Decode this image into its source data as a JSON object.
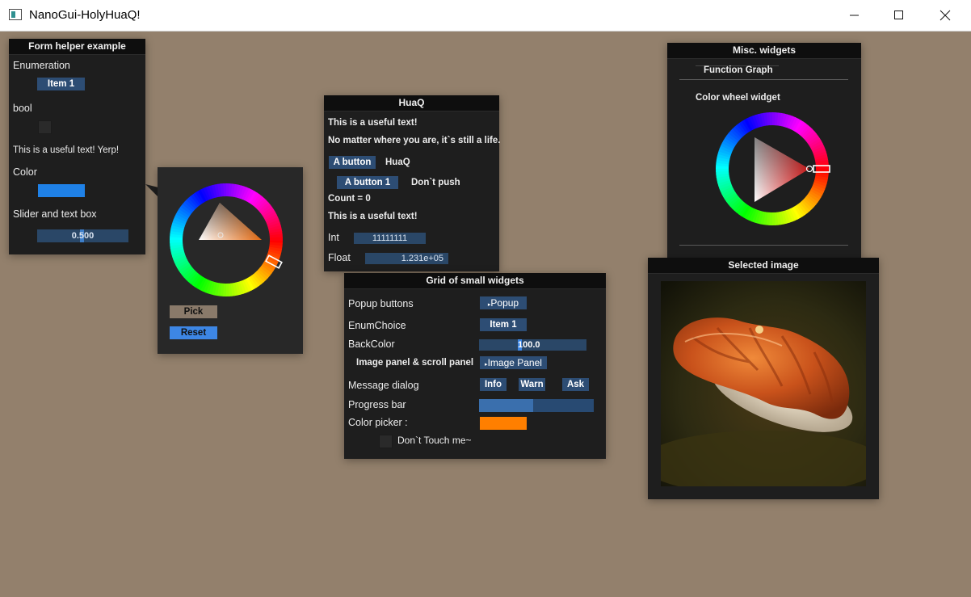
{
  "window": {
    "title": "NanoGui-HolyHuaQ!"
  },
  "form": {
    "title": "Form helper example",
    "enum_label": "Enumeration",
    "enum_value": "Item 1",
    "bool_label": "bool",
    "text": "This is a useful text! Yerp!",
    "color_label": "Color",
    "color_value": "#1f81e7",
    "slider_label": "Slider and text box",
    "slider_value": "0.500"
  },
  "picker_popup": {
    "pick_label": "Pick",
    "reset_label": "Reset",
    "selected_color": "#e36a12"
  },
  "huaq": {
    "title": "HuaQ",
    "text1": "This is a useful text!",
    "text2": "No matter where you are, it`s still a life.",
    "button_a": "A button",
    "side_label": "HuaQ",
    "button_a1": "A button 1",
    "dont_push": "Don`t push",
    "count": "Count = 0",
    "text3": "This is a useful text!",
    "int_label": "Int",
    "int_value": "11111111",
    "float_label": "Float",
    "float_value": "1.231e+05"
  },
  "grid": {
    "title": "Grid of small widgets",
    "popup_label": "Popup buttons",
    "popup_btn": "Popup",
    "enum_label": "EnumChoice",
    "enum_btn": "Item 1",
    "backcolor_label": "BackColor",
    "backcolor_value": "100.0",
    "image_label": "Image panel & scroll panel",
    "image_btn": "Image Panel",
    "msg_label": "Message dialog",
    "info": "Info",
    "warn": "Warn",
    "ask": "Ask",
    "progress_label": "Progress bar",
    "progress": 0.47,
    "colorpicker_label": "Color picker :",
    "colorpicker_value": "#ff7f00",
    "dont_touch": "Don`t Touch me~"
  },
  "misc": {
    "title": "Misc. widgets",
    "tab": "Function Graph",
    "wheel_label": "Color wheel widget"
  },
  "selected_image": {
    "title": "Selected image"
  },
  "icons": [
    "app-icon",
    "minimize-icon",
    "maximize-icon",
    "close-icon",
    "popup-arrow-icon"
  ]
}
